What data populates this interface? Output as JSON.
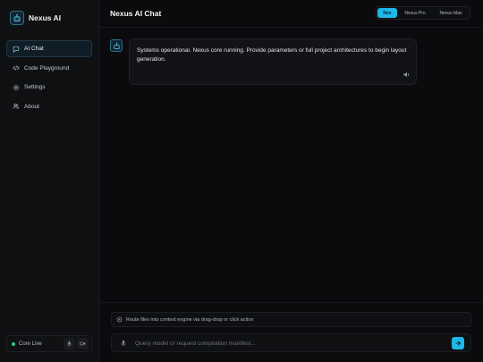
{
  "brand": {
    "name": "Nexus AI"
  },
  "sidebar": {
    "items": [
      {
        "label": "AI Chat",
        "icon": "chat-bubble-icon",
        "active": true
      },
      {
        "label": "Code Playground",
        "icon": "code-icon",
        "active": false
      },
      {
        "label": "Settings",
        "icon": "gear-icon",
        "active": false
      },
      {
        "label": "About",
        "icon": "users-icon",
        "active": false
      }
    ],
    "status": {
      "label": "Core Live",
      "color": "#2bd07a"
    }
  },
  "header": {
    "title": "Nexus AI Chat",
    "models": [
      "Nex",
      "Nexus Pro",
      "Nexus Max"
    ],
    "selected_model": "Nex"
  },
  "chat": {
    "messages": [
      {
        "role": "assistant",
        "text": "Systems operational. Nexus core running. Provide parameters or full project architectures to begin layout generation."
      }
    ]
  },
  "composer": {
    "route_hint": "Route files into context engine via drag-drop or click action",
    "placeholder": "Query model or request compilation manifest..."
  },
  "colors": {
    "accent": "#1fb6e8",
    "background": "#0b0b0d",
    "live": "#2bd07a"
  }
}
